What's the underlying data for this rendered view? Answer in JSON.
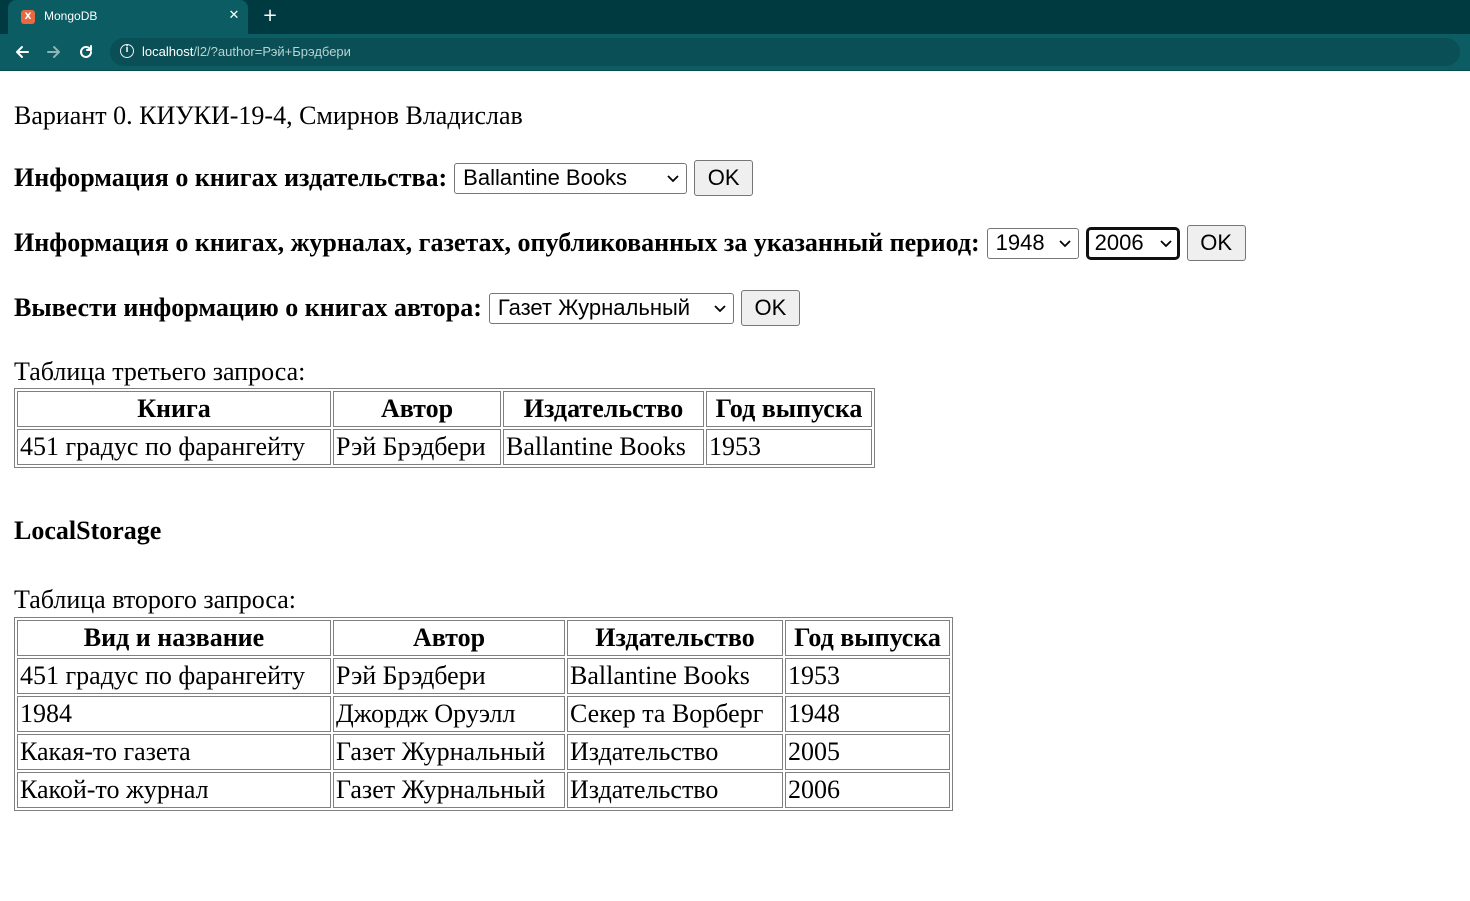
{
  "browser": {
    "tab_title": "MongoDB",
    "favicon_letter": "X",
    "url_host": "localhost",
    "url_rest": "/l2/?author=Рэй+Брэдбери",
    "icons": {
      "back": "arrow-left-icon",
      "forward": "arrow-right-icon",
      "reload": "reload-icon",
      "info": "info-icon",
      "close": "close-icon",
      "new_tab": "plus-icon"
    }
  },
  "page": {
    "heading": "Вариант 0. КИУКИ-19-4, Смирнов Владислав",
    "publisher_form": {
      "label": "Информация о книгах издательства:",
      "selected": "Ballantine Books",
      "ok": "OK"
    },
    "period_form": {
      "label": "Информация о книгах, журналах, газетах, опубликованных за указанный период:",
      "from_selected": "1948",
      "to_selected": "2006",
      "ok": "OK"
    },
    "author_form": {
      "label": "Вывести информацию о книгах автора:",
      "selected": "Газет Журнальный",
      "ok": "OK"
    },
    "third_query": {
      "caption": "Таблица третьего запроса:",
      "headers": [
        "Книга",
        "Автор",
        "Издательство",
        "Год выпуска"
      ],
      "rows": [
        [
          "451 градус по фарангейту",
          "Рэй Брэдбери",
          "Ballantine Books",
          "1953"
        ]
      ]
    },
    "local_storage_title": "LocalStorage",
    "second_query": {
      "caption": "Таблица второго запроса:",
      "headers": [
        "Вид и название",
        "Автор",
        "Издательство",
        "Год выпуска"
      ],
      "rows": [
        [
          "451 градус по фарангейту",
          "Рэй Брэдбери",
          "Ballantine Books",
          "1953"
        ],
        [
          "1984",
          "Джордж Оруэлл",
          "Секер та Ворберг",
          "1948"
        ],
        [
          "Какая-то газета",
          "Газет Журнальный",
          "Издательство",
          "2005"
        ],
        [
          "Какой-то журнал",
          "Газет Журнальный",
          "Издательство",
          "2006"
        ]
      ]
    }
  },
  "colors": {
    "tabbar": "#003a41",
    "toolbar": "#0b5d63",
    "favicon": "#e8683f",
    "button_bg": "#efefef",
    "border": "#808080"
  }
}
